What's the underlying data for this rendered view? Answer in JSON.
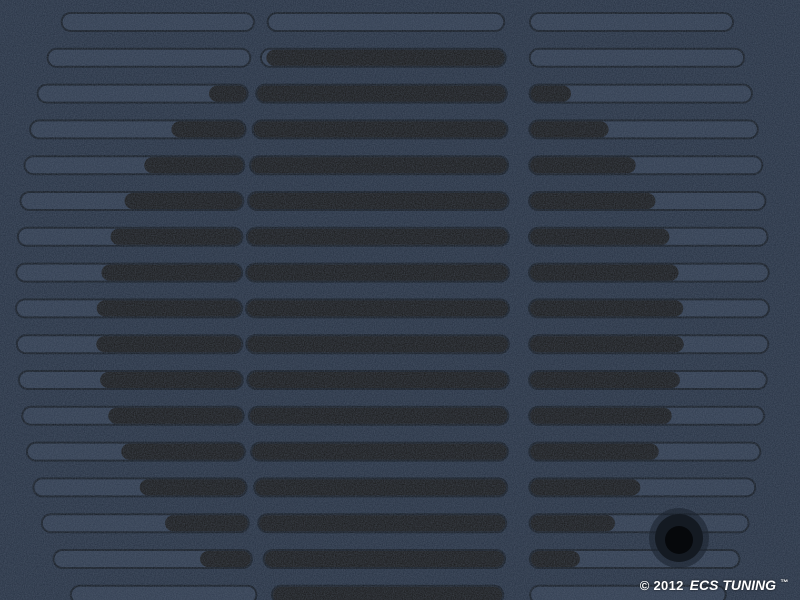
{
  "image": {
    "subject": "speaker-grille",
    "watermark": {
      "copyright": "© 2012",
      "brand": "ECS TUNING",
      "trademark": "™"
    },
    "colors": {
      "panel": "#253041",
      "panel_light": "#2f3b4e",
      "slot_shadow": "#121820",
      "speaker_cloth": "#161616",
      "speaker_cone": "#1c1f24"
    },
    "slots_per_column": 17
  }
}
